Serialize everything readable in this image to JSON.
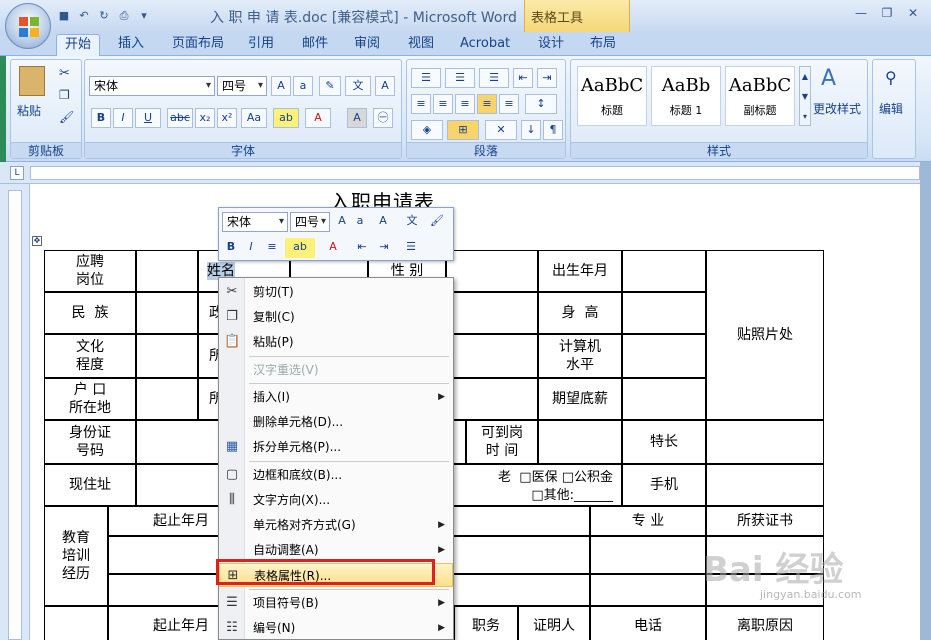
{
  "window": {
    "title": "入 职 申 请 表.doc [兼容模式] - Microsoft Word",
    "contextual_tab": "表格工具"
  },
  "tabs": [
    "开始",
    "插入",
    "页面布局",
    "引用",
    "邮件",
    "审阅",
    "视图",
    "Acrobat",
    "设计",
    "布局"
  ],
  "active_tab": "开始",
  "ribbon": {
    "clipboard": {
      "paste": "粘贴",
      "label": "剪贴板"
    },
    "font": {
      "family": "宋体",
      "size": "四号",
      "label": "字体"
    },
    "paragraph": {
      "label": "段落"
    },
    "styles": {
      "label": "样式",
      "items": [
        {
          "preview": "AaBbC",
          "name": "标题"
        },
        {
          "preview": "AaBb",
          "name": "标题 1"
        },
        {
          "preview": "AaBbC",
          "name": "副标题"
        }
      ],
      "change": "更改样式"
    },
    "editing": {
      "label": "编辑"
    }
  },
  "document": {
    "title": "入职申请表",
    "cells": {
      "r1": [
        "应聘\n岗位",
        "姓名",
        "性  别",
        "出生年月",
        "贴照片处"
      ],
      "r2": [
        "民  族",
        "政",
        "身  高"
      ],
      "r3": [
        "文化\n程度",
        "所",
        "计算机\n水平"
      ],
      "r4": [
        "户  口\n所在地",
        "所",
        "期望底薪"
      ],
      "r5": [
        "身份证\n号码",
        "可到岗\n时  间",
        "特长"
      ],
      "r6": [
        "现住址",
        "老",
        "□医保  □公积金",
        "□其他:______",
        "手机"
      ],
      "edu": [
        "教育\n培训\n经历",
        "起止年月",
        "专  业",
        "所获证书"
      ],
      "work": [
        "起止年月",
        "职务",
        "证明人",
        "电话",
        "离职原因"
      ]
    }
  },
  "mini_toolbar": {
    "font": "宋体",
    "size": "四号"
  },
  "context_menu": {
    "items": [
      {
        "label": "剪切(T)",
        "icon": "scissors-icon",
        "disabled": false,
        "submenu": false
      },
      {
        "label": "复制(C)",
        "icon": "copy-icon",
        "disabled": false,
        "submenu": false
      },
      {
        "label": "粘贴(P)",
        "icon": "paste-icon",
        "disabled": false,
        "submenu": false
      },
      {
        "label": "汉字重选(V)",
        "icon": "",
        "disabled": true,
        "submenu": false
      },
      {
        "label": "插入(I)",
        "icon": "",
        "disabled": false,
        "submenu": true
      },
      {
        "label": "删除单元格(D)...",
        "icon": "",
        "disabled": false,
        "submenu": false
      },
      {
        "label": "拆分单元格(P)...",
        "icon": "split-cells-icon",
        "disabled": false,
        "submenu": false
      },
      {
        "label": "边框和底纹(B)...",
        "icon": "borders-icon",
        "disabled": false,
        "submenu": false
      },
      {
        "label": "文字方向(X)...",
        "icon": "text-direction-icon",
        "disabled": false,
        "submenu": false
      },
      {
        "label": "单元格对齐方式(G)",
        "icon": "",
        "disabled": false,
        "submenu": true
      },
      {
        "label": "自动调整(A)",
        "icon": "",
        "disabled": false,
        "submenu": true
      },
      {
        "label": "表格属性(R)...",
        "icon": "table-properties-icon",
        "disabled": false,
        "submenu": false,
        "highlighted": true
      },
      {
        "label": "项目符号(B)",
        "icon": "bullets-icon",
        "disabled": false,
        "submenu": true
      },
      {
        "label": "编号(N)",
        "icon": "numbering-icon",
        "disabled": false,
        "submenu": true
      }
    ]
  },
  "watermark": {
    "text": "Bai 经验",
    "sub": "jingyan.baidu.com"
  }
}
